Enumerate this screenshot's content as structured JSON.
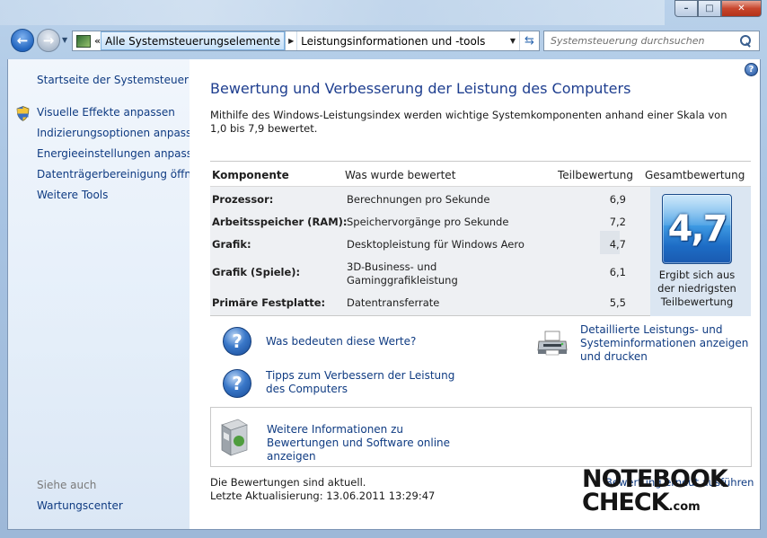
{
  "window": {
    "min_glyph": "–",
    "max_glyph": "□",
    "close_glyph": "✕"
  },
  "nav": {
    "back_glyph": "←",
    "forward_glyph": "→",
    "breadcrumb_overflow": "«",
    "breadcrumbs": [
      "Alle Systemsteuerungselemente",
      "Leistungsinformationen und -tools"
    ],
    "search_placeholder": "Systemsteuerung durchsuchen"
  },
  "sidebar": {
    "home_link": "Startseite der Systemsteuerung",
    "tasks": [
      "Visuelle Effekte anpassen",
      "Indizierungsoptionen anpassen",
      "Energieeinstellungen anpassen",
      "Datenträgerbereinigung öffnen",
      "Weitere Tools"
    ],
    "see_also_heading": "Siehe auch",
    "see_also_items": [
      "Wartungscenter"
    ]
  },
  "main": {
    "help_glyph": "?",
    "title": "Bewertung und Verbesserung der Leistung des Computers",
    "intro": "Mithilfe des Windows-Leistungsindex werden wichtige Systemkomponenten anhand einer Skala von 1,0 bis 7,9 bewertet.",
    "table": {
      "headers": {
        "component": "Komponente",
        "rated": "Was wurde bewertet",
        "subscore": "Teilbewertung",
        "basescore": "Gesamtbewertung"
      },
      "rows": [
        {
          "component": "Prozessor:",
          "rated": "Berechnungen pro Sekunde",
          "subscore": "6,9"
        },
        {
          "component": "Arbeitsspeicher (RAM):",
          "rated": "Speichervorgänge pro Sekunde",
          "subscore": "7,2"
        },
        {
          "component": "Grafik:",
          "rated": "Desktopleistung für Windows Aero",
          "subscore": "4,7"
        },
        {
          "component": "Grafik (Spiele):",
          "rated": "3D-Business- und Gaminggrafikleistung",
          "subscore": "6,1"
        },
        {
          "component": "Primäre Festplatte:",
          "rated": "Datentransferrate",
          "subscore": "5,5"
        }
      ],
      "base_score": "4,7",
      "base_score_note": "Ergibt sich aus der niedrigsten Teilbewertung"
    },
    "links": {
      "what_do_numbers_mean": "Was bedeuten diese Werte?",
      "tips": "Tipps zum Verbessern der Leistung des Computers",
      "details": "Detaillierte Leistungs- und Systeminformationen anzeigen und drucken",
      "more_info": "Weitere Informationen zu Bewertungen und Software online anzeigen"
    },
    "status": {
      "line1": "Die Bewertungen sind aktuell.",
      "line2": "Letzte Aktualisierung: 13.06.2011 13:29:47"
    },
    "rerun": "Bewertung erneut ausführen"
  },
  "watermark": {
    "line1": "NOTEBOOK",
    "line2": "CHECK",
    "suffix": ".com"
  },
  "icons": {
    "shield": "uac-shield-icon",
    "question": "help-question-icon",
    "printer": "printer-icon",
    "software_box": "software-box-icon"
  }
}
